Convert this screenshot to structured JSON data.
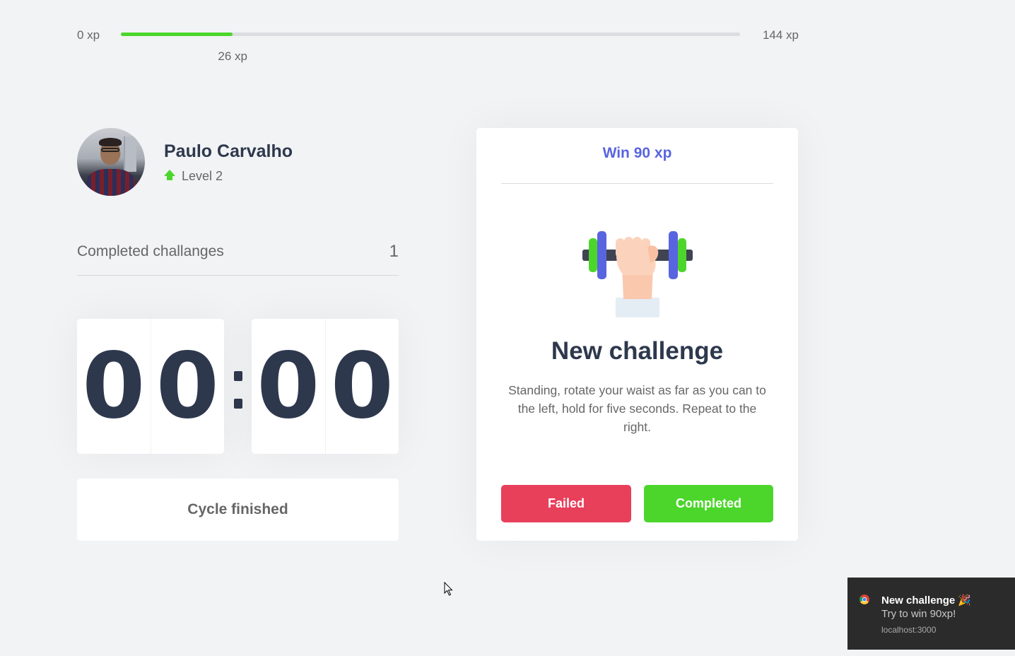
{
  "xp": {
    "min_label": "0 xp",
    "max_label": "144 xp",
    "current_label": "26 xp",
    "current_value": 26,
    "max_value": 144
  },
  "profile": {
    "name": "Paulo Carvalho",
    "level_label": "Level 2",
    "level_icon": "level-up-arrow-icon",
    "avatar": "profile-photo"
  },
  "completed_challenges": {
    "label": "Completed challanges",
    "count": "1"
  },
  "countdown": {
    "minutes": [
      "0",
      "0"
    ],
    "seconds": [
      "0",
      "0"
    ]
  },
  "cycle_button": {
    "label": "Cycle finished"
  },
  "challenge": {
    "reward_label": "Win 90 xp",
    "icon": "dumbbell-body-icon",
    "title": "New challenge",
    "description": "Standing, rotate your waist as far as you can to the left, hold for five seconds. Repeat to the right.",
    "failed_label": "Failed",
    "completed_label": "Completed"
  },
  "notification": {
    "title": "New challenge 🎉",
    "body": "Try to win 90xp!",
    "source": "localhost:3000",
    "icon": "chrome-icon"
  },
  "colors": {
    "background": "#f2f3f5",
    "green": "#4cd62b",
    "red": "#e83f5b",
    "blue": "#5965e0",
    "title": "#2e384d",
    "text": "#666666"
  }
}
